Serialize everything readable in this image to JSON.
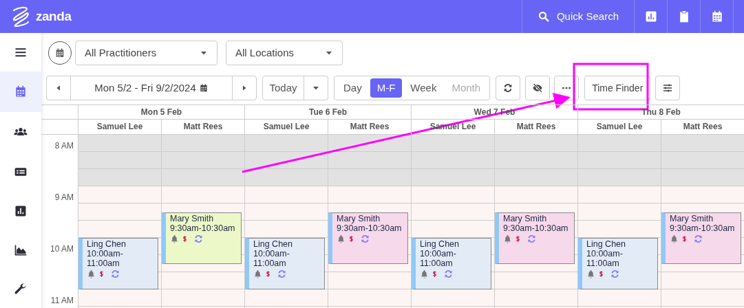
{
  "topbar": {
    "brand": "zanda",
    "quick_search": "Quick Search"
  },
  "sidebar": {
    "items": [
      {
        "kind": "menu",
        "selected": false
      },
      {
        "kind": "calendar",
        "selected": true
      },
      {
        "kind": "people",
        "selected": false
      },
      {
        "kind": "card",
        "selected": false
      },
      {
        "kind": "bars",
        "selected": false
      },
      {
        "kind": "area",
        "selected": false
      },
      {
        "kind": "wrench",
        "selected": false
      }
    ]
  },
  "filters": {
    "practitioners": "All Practitioners",
    "locations": "All Locations"
  },
  "date_nav": {
    "range": "Mon 5/2 - Fri 9/2/2024",
    "today": "Today"
  },
  "views": [
    {
      "label": "Day",
      "selected": false,
      "disabled": false
    },
    {
      "label": "M-F",
      "selected": true,
      "disabled": false
    },
    {
      "label": "Week",
      "selected": false,
      "disabled": false
    },
    {
      "label": "Month",
      "selected": false,
      "disabled": true
    }
  ],
  "time_finder": "Time Finder",
  "calendar": {
    "hours": [
      "8 AM",
      "9 AM",
      "10 AM",
      "11 AM"
    ],
    "days": [
      {
        "label": "Mon 5 Feb",
        "columns": [
          {
            "practitioner": "Samuel Lee",
            "appointments": [
              {
                "kind": "ten",
                "patient": "Ling Chen",
                "time": "10:00am-11:00am",
                "color": "#e3ebf7"
              }
            ]
          },
          {
            "practitioner": "Matt Rees",
            "appointments": [
              {
                "kind": "ninethirty",
                "patient": "Mary Smith",
                "time": "9:30am-10:30am",
                "color": "#ecf8c8"
              }
            ]
          }
        ]
      },
      {
        "label": "Tue 6 Feb",
        "columns": [
          {
            "practitioner": "Samuel Lee",
            "appointments": [
              {
                "kind": "ten",
                "patient": "Ling Chen",
                "time": "10:00am-11:00am",
                "color": "#e3ebf7"
              }
            ]
          },
          {
            "practitioner": "Matt Rees",
            "appointments": [
              {
                "kind": "ninethirty",
                "patient": "Mary Smith",
                "time": "9:30am-10:30am",
                "color": "#f7d9ec"
              }
            ]
          }
        ]
      },
      {
        "label": "Wed 7 Feb",
        "columns": [
          {
            "practitioner": "Samuel Lee",
            "appointments": [
              {
                "kind": "ten",
                "patient": "Ling Chen",
                "time": "10:00am-11:00am",
                "color": "#e3ebf7"
              }
            ]
          },
          {
            "practitioner": "Matt Rees",
            "appointments": [
              {
                "kind": "ninethirty",
                "patient": "Mary Smith",
                "time": "9:30am-10:30am",
                "color": "#f7d9ec"
              }
            ]
          }
        ]
      },
      {
        "label": "Thu 8 Feb",
        "columns": [
          {
            "practitioner": "Samuel Lee",
            "appointments": [
              {
                "kind": "ten",
                "patient": "Ling Chen",
                "time": "10:00am-11:00am",
                "color": "#e3ebf7"
              }
            ]
          },
          {
            "practitioner": "Matt Rees",
            "appointments": [
              {
                "kind": "ninethirty",
                "patient": "Mary Smith",
                "time": "9:30am-10:30am",
                "color": "#f7d9ec"
              }
            ]
          }
        ]
      }
    ]
  }
}
